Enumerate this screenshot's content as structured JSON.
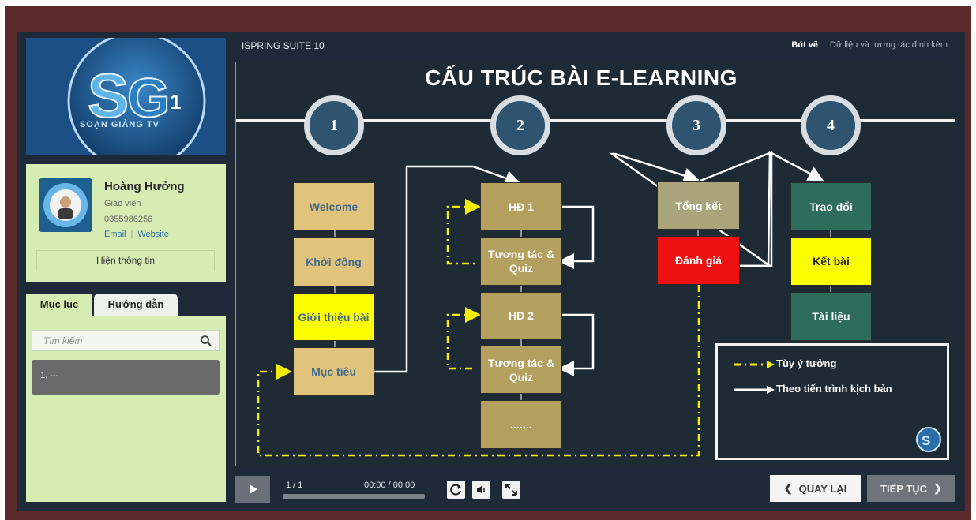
{
  "header": {
    "suite_title": "ISPRING SUITE 10",
    "pen_tool": "Bút vẽ",
    "attachments": "Dữ liệu và tương tác đính kèm"
  },
  "sidebar": {
    "logo_text": "SOẠN GIẢNG TV",
    "profile": {
      "name": "Hoàng Hưởng",
      "role": "Giáo viên",
      "phone": "0355936256",
      "email_label": "Email",
      "website_label": "Website",
      "show_info_label": "Hiện thông tin"
    },
    "tabs": [
      "Mục lục",
      "Hướng dẫn"
    ],
    "search_placeholder": "Tìm kiếm",
    "toc_items": [
      "1. ---"
    ]
  },
  "slide": {
    "title": "CẤU TRÚC BÀI E-LEARNING",
    "steps": [
      "1",
      "2",
      "3",
      "4"
    ],
    "col1": [
      "Welcome",
      "Khởi động",
      "Giới thiệu bài",
      "Mục tiêu"
    ],
    "col2": [
      "HĐ 1",
      "Tương tác & Quiz",
      "HĐ 2",
      "Tương tác & Quiz",
      "......."
    ],
    "col3": [
      "Tổng kết",
      "Đánh giá"
    ],
    "col4": [
      "Trao đổi",
      "Kết bài",
      "Tài liệu"
    ],
    "legend": {
      "optional": "Tùy ý tưởng",
      "scripted": "Theo tiến trình kịch bản"
    },
    "colors": {
      "tan": "#e2c37c",
      "red": "#ef1111",
      "green": "#2e6c5e",
      "yellow": "#fbff00",
      "dashed_line": "#f5ee00"
    }
  },
  "controls": {
    "slide_count": "1 / 1",
    "timecode": "00:00 / 00:00",
    "prev_label": "QUAY LẠI",
    "next_label": "TIẾP TỤC"
  }
}
